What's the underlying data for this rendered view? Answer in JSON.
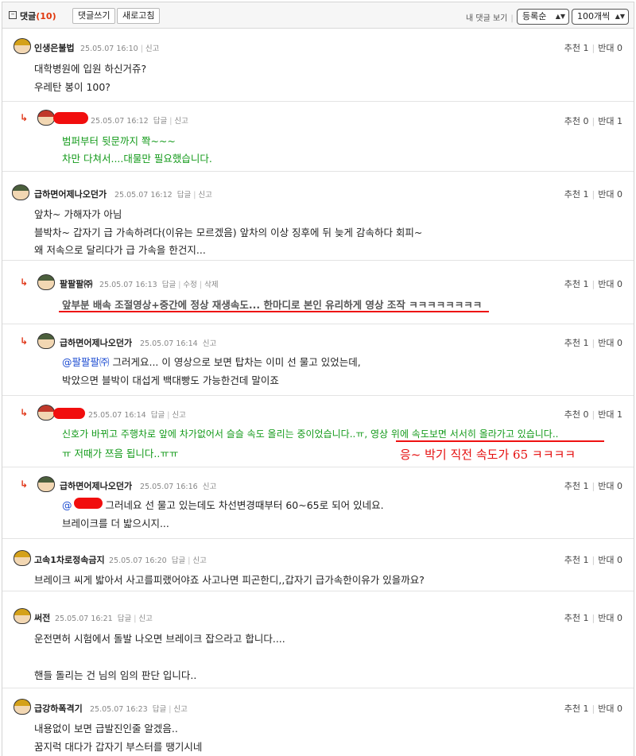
{
  "toolbar": {
    "collapse_symbol": "–",
    "title": "댓글",
    "count": "(10)",
    "write_button": "댓글쓰기",
    "refresh_button": "새로고침",
    "my_comments": "내 댓글 보기",
    "sort_select": "등록순",
    "per_page_select": "100개씩"
  },
  "labels": {
    "reply": "답글",
    "report": "신고",
    "edit": "수정",
    "delete": "삭제",
    "up": "추천",
    "down": "반대"
  },
  "comments": [
    {
      "nick": "인생은불법",
      "time": "25.05.07 16:10",
      "up": "1",
      "down": "0",
      "lines": [
        "대학병원에 입원 하신거쥬?",
        "우레탄 봉이 100?"
      ]
    },
    {
      "nick": "",
      "time": "25.05.07 16:12",
      "up": "0",
      "down": "1",
      "lines": [
        "범퍼부터 뒷문까지 쫙~~~",
        "차만 다쳐서....대물만 필요했습니다."
      ]
    },
    {
      "nick": "급하면어제나오던가",
      "time": "25.05.07 16:12",
      "up": "1",
      "down": "0",
      "lines": [
        "앞차~ 가해자가 아님",
        "블박차~ 갑자기 급 가속하려다(이유는 모르겠음) 앞차의 이상 징후에 뒤 늦게 감속하다 회피~",
        "왜 저속으로 달리다가 급 가속을 한건지..."
      ]
    },
    {
      "nick": "팔팔팔㈜",
      "time": "25.05.07 16:13",
      "up": "1",
      "down": "0",
      "lines": [
        "앞부분 배속 조절영상+중간에 정상 재생속도... 한마디로 본인 유리하게 영상 조작 ㅋㅋㅋㅋㅋㅋㅋㅋ"
      ]
    },
    {
      "nick": "급하면어제나오던가",
      "time": "25.05.07 16:14",
      "up": "1",
      "down": "0",
      "mention": "@팔팔팔㈜",
      "lines": [
        " 그러게요... 이 영상으로 보면 탑차는 이미 선 물고 있었는데,",
        "박았으면 블박이 대섭게 백대빵도 가능한건데 말이죠"
      ]
    },
    {
      "nick": "",
      "time": "25.05.07 16:14",
      "up": "0",
      "down": "1",
      "lines": [
        "신호가 바뀌고 주행차로 앞에 차가없어서 슬슬 속도 올리는 중이었습니다..ㅠ, 영상 위에 속도보면 서서히 올라가고 있습니다..",
        "ㅠ 저때가 쯔음 됩니다..ㅠㅠ"
      ],
      "handwritten": "응~ 박기 직전 속도가 65 ㅋㅋㅋㅋ"
    },
    {
      "nick": "급하면어제나오던가",
      "time": "25.05.07 16:16",
      "up": "1",
      "down": "0",
      "mention": "@",
      "lines": [
        " 그러네요 선 물고 있는데도 차선변경때부터 60~65로 되어 있네요.",
        "브레이크를 더 밟으시지..."
      ]
    },
    {
      "nick": "고속1차로정속금지",
      "time": "25.05.07 16:20",
      "up": "1",
      "down": "0",
      "lines": [
        "브레이크 씨게 밟아서 사고를피랬어야죠 사고나면 피곤한디,,갑자기 급가속한이유가 있을까요?"
      ]
    },
    {
      "nick": "써전",
      "time": "25.05.07 16:21",
      "up": "1",
      "down": "0",
      "lines": [
        "운전면허 시험에서 돌발 나오면 브레이크 잡으라고 합니다....",
        "핸들 돌리는 건 님의 임의 판단 입니다.."
      ]
    },
    {
      "nick": "급강하폭격기",
      "time": "25.05.07 16:23",
      "up": "1",
      "down": "0",
      "lines": [
        "내용없이 보면 급발진인줄 알겠음..",
        "꿈지럭 대다가 갑자기 부스터를 땡기시네"
      ]
    }
  ]
}
